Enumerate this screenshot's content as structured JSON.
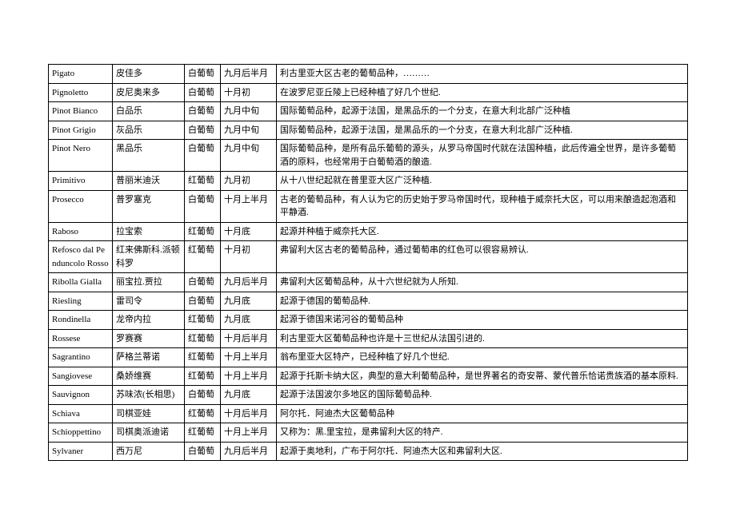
{
  "table": {
    "rows": [
      {
        "col1": "Pigato",
        "col2": "皮佳多",
        "col3": "白葡萄",
        "col4": "九月后半月",
        "col5": "利古里亚大区古老的葡萄品种，………"
      },
      {
        "col1": "Pignoletto",
        "col2": "皮尼奥来多",
        "col3": "白葡萄",
        "col4": "十月初",
        "col5": "在波罗尼亚丘陵上已经种植了好几个世纪."
      },
      {
        "col1": "Pinot Bianco",
        "col2": "白品乐",
        "col3": "白葡萄",
        "col4": "九月中旬",
        "col5": "国际葡萄品种，起源于法国，是黑品乐的一个分支，在意大利北部广泛种植"
      },
      {
        "col1": "Pinot Grigio",
        "col2": "灰品乐",
        "col3": "白葡萄",
        "col4": "九月中旬",
        "col5": "国际葡萄品种，起源于法国，是黑品乐的一个分支，在意大利北部广泛种植."
      },
      {
        "col1": "Pinot Nero",
        "col2": "黑品乐",
        "col3": "白葡萄",
        "col4": "九月中旬",
        "col5": "国际葡萄品种，是所有品乐葡萄的源头，从罗马帝国时代就在法国种植，此后传遍全世界，是许多葡萄酒的原料，也经常用于白葡萄酒的酿造."
      },
      {
        "col1": "Primitivo",
        "col2": "普丽米迪沃",
        "col3": "红葡萄",
        "col4": "九月初",
        "col5": "从十八世纪起就在普里亚大区广泛种植."
      },
      {
        "col1": "Prosecco",
        "col2": "普罗塞克",
        "col3": "白葡萄",
        "col4": "十月上半月",
        "col5": "古老的葡萄品种，有人认为它的历史始于罗马帝国时代，现种植于威奈托大区，可以用来酿造起泡酒和平静酒."
      },
      {
        "col1": "Raboso",
        "col2": "拉宝索",
        "col3": "红葡萄",
        "col4": "十月底",
        "col5": "起源并种植于威奈托大区."
      },
      {
        "col1": "Refosco dal Penduncolo Rosso",
        "col2": "红来佛斯科.派顿科罗",
        "col3": "红葡萄",
        "col4": "十月初",
        "col5": "弗留利大区古老的葡萄品种，通过葡萄串的红色可以很容易辨认."
      },
      {
        "col1": "Ribolla Gialla",
        "col2": "丽宝拉.贾拉",
        "col3": "白葡萄",
        "col4": "九月后半月",
        "col5": "弗留利大区葡萄品种，从十六世纪就为人所知."
      },
      {
        "col1": "Riesling",
        "col2": "雷司令",
        "col3": "白葡萄",
        "col4": "九月底",
        "col5": "起源于德国的葡萄品种."
      },
      {
        "col1": "Rondinella",
        "col2": "龙帝内拉",
        "col3": "红葡萄",
        "col4": "九月底",
        "col5": "起源于德国来诺河谷的葡萄品种"
      },
      {
        "col1": "Rossese",
        "col2": "罗赛赛",
        "col3": "红葡萄",
        "col4": "十月后半月",
        "col5": "利古里亚大区葡萄品种也许是十三世纪从法国引进的."
      },
      {
        "col1": "Sagrantino",
        "col2": "萨格兰蒂诺",
        "col3": "红葡萄",
        "col4": "十月上半月",
        "col5": "翁布里亚大区特产，已经种植了好几个世纪."
      },
      {
        "col1": "Sangiovese",
        "col2": "桑娇维赛",
        "col3": "红葡萄",
        "col4": "十月上半月",
        "col5": "起源于托斯卡纳大区，典型的意大利葡萄品种，是世界著名的奇安蒂、蒙代普乐恰诺贵族酒的基本原料."
      },
      {
        "col1": "Sauvignon",
        "col2": "苏味浓(长相思)",
        "col3": "白葡萄",
        "col4": "九月底",
        "col5": "起源于法国波尔多地区的国际葡萄品种."
      },
      {
        "col1": "Schiava",
        "col2": "司棋亚娃",
        "col3": "红葡萄",
        "col4": "十月后半月",
        "col5": "阿尔托．阿迪杰大区葡萄品种"
      },
      {
        "col1": "Schioppettino",
        "col2": "司棋奥派迪诺",
        "col3": "红葡萄",
        "col4": "十月上半月",
        "col5": "又称为：黑.里宝拉，是弗留利大区的特产."
      },
      {
        "col1": "Sylvaner",
        "col2": "西万尼",
        "col3": "白葡萄",
        "col4": "九月后半月",
        "col5": "起源于奥地利，广布于阿尔托．阿迪杰大区和弗留利大区."
      }
    ]
  }
}
